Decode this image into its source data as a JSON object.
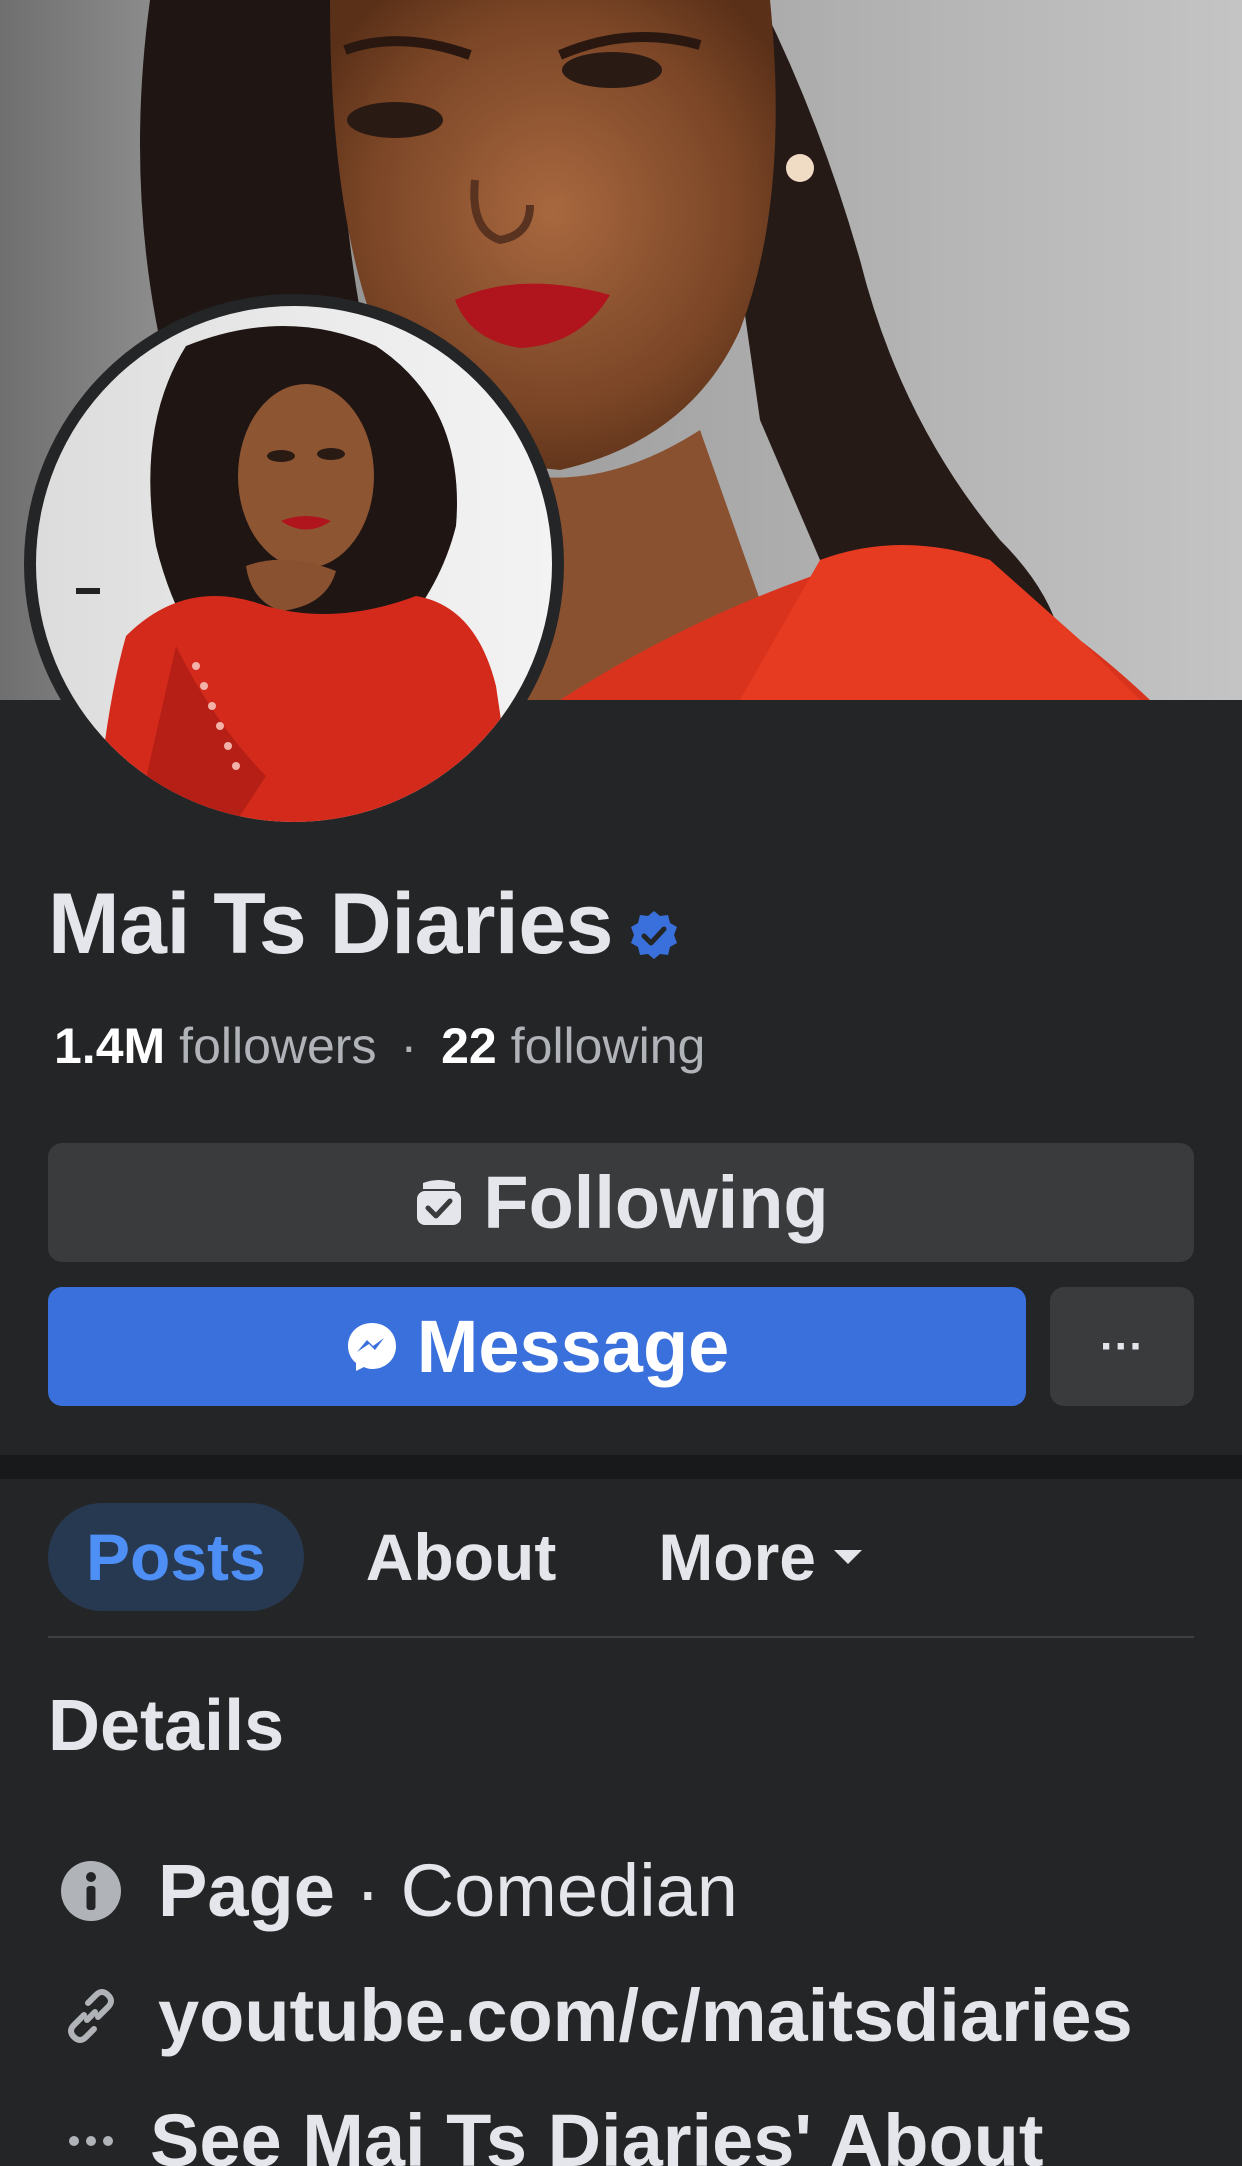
{
  "profile": {
    "name": "Mai Ts Diaries",
    "followers_count": "1.4M",
    "followers_label": "followers",
    "following_count": "22",
    "following_label": "following",
    "separator": "·"
  },
  "actions": {
    "following_label": "Following",
    "message_label": "Message",
    "more_label": "···"
  },
  "tabs": [
    {
      "label": "Posts",
      "active": true
    },
    {
      "label": "About",
      "active": false
    },
    {
      "label": "More",
      "active": false
    }
  ],
  "details": {
    "title": "Details",
    "page_type_prefix": "Page",
    "page_type_sep": "·",
    "page_type": "Comedian",
    "link": "youtube.com/c/maitsdiaries",
    "see_about": "See Mai Ts Diaries' About"
  },
  "colors": {
    "background": "#242526",
    "button_gray": "#3a3b3c",
    "primary_blue": "#3a70dc",
    "active_tab_bg": "#263951",
    "active_tab_text": "#4e8ff5",
    "verified_blue": "#3a70dc"
  },
  "icons": {
    "verified": "verified-badge-icon",
    "following": "following-check-icon",
    "message": "messenger-icon",
    "more": "more-dots-icon",
    "info": "info-icon",
    "link": "link-icon",
    "see_more": "more-dots-icon"
  }
}
